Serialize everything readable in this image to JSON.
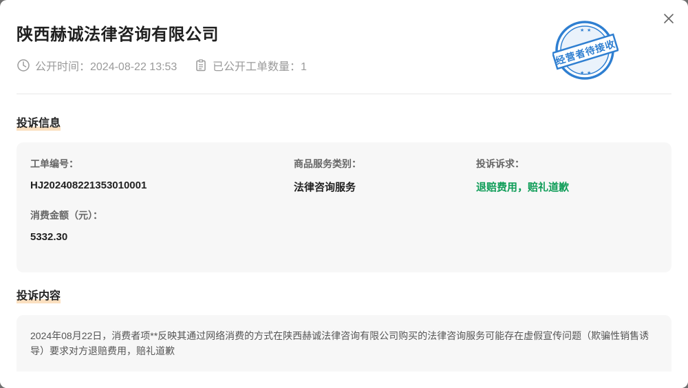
{
  "header": {
    "company_name": "陕西赫诚法律咨询有限公司",
    "publish_time": "公开时间：2024-08-22 13:53",
    "public_count": "已公开工单数量：1",
    "stamp_text": "经营者待接收"
  },
  "complaint_info": {
    "section_title": "投诉信息",
    "ticket_label": "工单编号：",
    "ticket_value": "HJ20240822135301000​1",
    "category_label": "商品服务类别：",
    "category_value": "法律咨询服务",
    "demand_label": "投诉诉求：",
    "demand_value": "退赔费用，赔礼道歉",
    "amount_label": "消费金额（元）：",
    "amount_value": "5332.30"
  },
  "complaint_content": {
    "section_title": "投诉内容",
    "text": "2024年08月22日，消费者项**反映其通过网络消费的方式在陕西赫诚法律咨询有限公司购买的法律咨询服务可能存在虚假宣传问题（欺骗性销售诱导）要求对方退赔费用，赔礼道歉"
  },
  "icons": {
    "close": "close-icon",
    "clock": "clock-icon",
    "clipboard": "clipboard-icon"
  },
  "colors": {
    "stamp_blue": "#2f7fd1",
    "demand_green": "#0f9d58",
    "section_underline": "#fbe0c0"
  }
}
